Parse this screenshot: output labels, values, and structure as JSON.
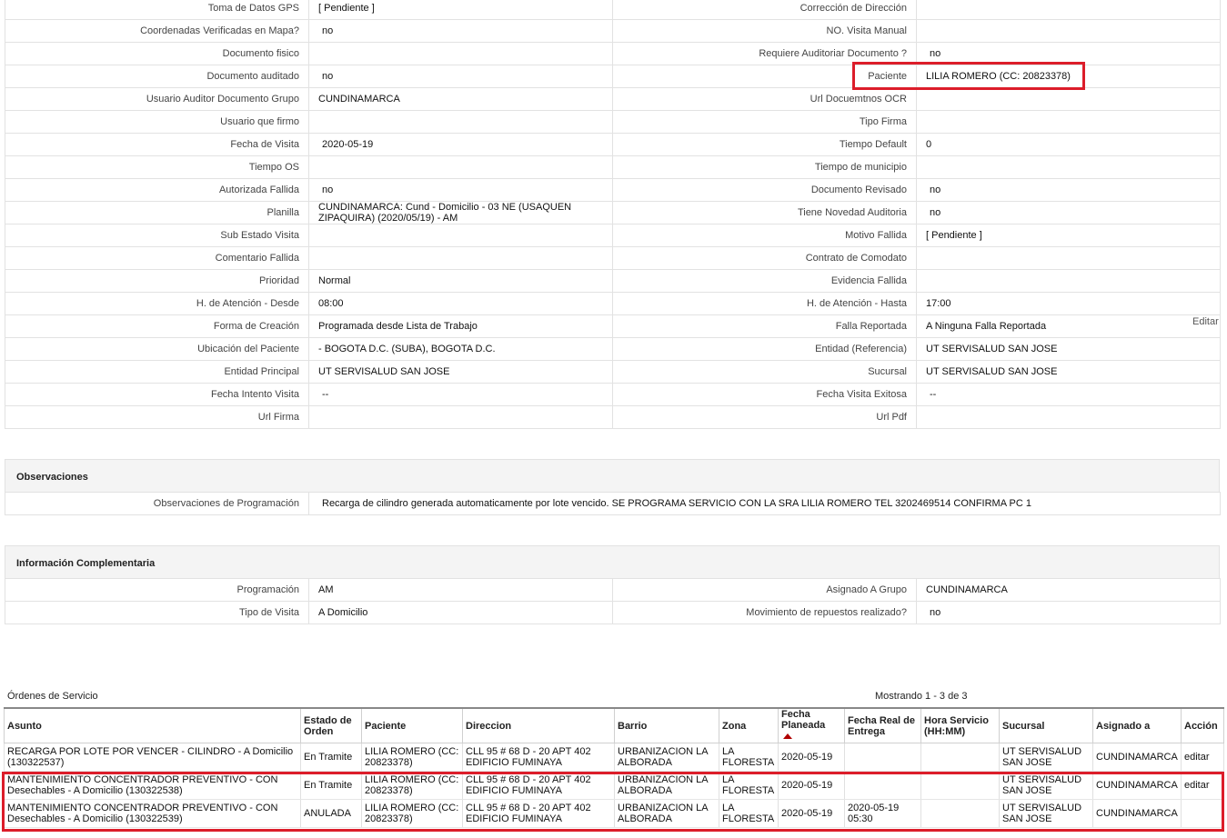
{
  "detail_rows": [
    {
      "l1": "Toma de Datos GPS",
      "v1": "[ Pendiente ]",
      "l2": "Corrección de Dirección",
      "v2": ""
    },
    {
      "l1": "Coordenadas Verificadas en Mapa?",
      "v1": "no",
      "l2": "NO. Visita Manual",
      "v2": ""
    },
    {
      "l1": "Documento fisico",
      "v1": "",
      "l2": "Requiere Auditoriar Documento ?",
      "v2": "no"
    },
    {
      "l1": "Documento auditado",
      "v1": "no",
      "l2": "Paciente",
      "v2": "LILIA ROMERO (CC: 20823378)"
    },
    {
      "l1": "Usuario Auditor Documento Grupo",
      "v1": "CUNDINAMARCA",
      "l2": "Url Docuemtnos OCR",
      "v2": ""
    },
    {
      "l1": "Usuario que firmo",
      "v1": "",
      "l2": "Tipo Firma",
      "v2": ""
    },
    {
      "l1": "Fecha de Visita",
      "v1": "2020-05-19",
      "l2": "Tiempo Default",
      "v2": "0"
    },
    {
      "l1": "Tiempo OS",
      "v1": "",
      "l2": "Tiempo de municipio",
      "v2": ""
    },
    {
      "l1": "Autorizada Fallida",
      "v1": "no",
      "l2": "Documento Revisado",
      "v2": "no"
    },
    {
      "l1": "Planilla",
      "v1": "CUNDINAMARCA: Cund - Domicilio - 03 NE (USAQUEN ZIPAQUIRA) (2020/05/19) - AM",
      "l2": "Tiene Novedad Auditoria",
      "v2": "no"
    },
    {
      "l1": "Sub Estado Visita",
      "v1": "",
      "l2": "Motivo Fallida",
      "v2": "[ Pendiente ]"
    },
    {
      "l1": "Comentario Fallida",
      "v1": "",
      "l2": "Contrato de Comodato",
      "v2": ""
    },
    {
      "l1": "Prioridad",
      "v1": "Normal",
      "l2": "Evidencia Fallida",
      "v2": ""
    },
    {
      "l1": "H. de Atención - Desde",
      "v1": "08:00",
      "l2": "H. de Atención - Hasta",
      "v2": "17:00"
    },
    {
      "l1": "Forma de Creación",
      "v1": "Programada desde Lista de Trabajo",
      "l2": "Falla Reportada",
      "v2": "A Ninguna Falla Reportada"
    },
    {
      "l1": "Ubicación del Paciente",
      "v1": "- BOGOTA D.C. (SUBA), BOGOTA D.C.",
      "l2": "Entidad (Referencia)",
      "v2": "UT SERVISALUD SAN JOSE"
    },
    {
      "l1": "Entidad Principal",
      "v1": "UT SERVISALUD SAN JOSE",
      "l2": "Sucursal",
      "v2": "UT SERVISALUD SAN JOSE"
    },
    {
      "l1": "Fecha Intento Visita",
      "v1": "--",
      "l2": "Fecha Visita Exitosa",
      "v2": "--"
    },
    {
      "l1": "Url Firma",
      "v1": "",
      "l2": "Url Pdf",
      "v2": ""
    }
  ],
  "editar_label": "Editar",
  "observaciones": {
    "title": "Observaciones",
    "label": "Observaciones de Programación",
    "value": "Recarga de cilindro generada automaticamente por lote vencido. SE PROGRAMA SERVICIO CON LA SRA LILIA ROMERO TEL 3202469514 CONFIRMA PC 1"
  },
  "complementaria": {
    "title": "Información Complementaria",
    "rows": [
      {
        "l1": "Programación",
        "v1": "AM",
        "l2": "Asignado A Grupo",
        "v2": "CUNDINAMARCA"
      },
      {
        "l1": "Tipo de Visita",
        "v1": "A Domicilio",
        "l2": "Movimiento de repuestos realizado?",
        "v2": "no"
      }
    ]
  },
  "orders": {
    "title": "Órdenes de Servicio",
    "count_text": "Mostrando 1 - 3 de 3",
    "headers": [
      "Asunto",
      "Estado de Orden",
      "Paciente",
      "Direccion",
      "Barrio",
      "Zona",
      "Fecha Planeada",
      "Fecha Real de Entrega",
      "Hora Servicio (HH:MM)",
      "Sucursal",
      "Asignado a",
      "Acción"
    ],
    "rows": [
      {
        "asunto": "RECARGA POR LOTE POR VENCER - CILINDRO - A Domicilio (130322537)",
        "estado": "En Tramite",
        "paciente": "LILIA ROMERO (CC: 20823378)",
        "direccion": "CLL 95 # 68 D - 20 APT 402 EDIFICIO FUMINAYA",
        "barrio": "URBANIZACION LA ALBORADA",
        "zona": "LA FLORESTA",
        "fecha_planeada": "2020-05-19",
        "fecha_real": "",
        "hora": "",
        "sucursal": "UT SERVISALUD SAN JOSE",
        "asignado": "CUNDINAMARCA",
        "accion": "editar"
      },
      {
        "asunto": "MANTENIMIENTO CONCENTRADOR PREVENTIVO - CON Desechables - A Domicilio (130322538)",
        "estado": "En Tramite",
        "paciente": "LILIA ROMERO (CC: 20823378)",
        "direccion": "CLL 95 # 68 D - 20 APT 402 EDIFICIO FUMINAYA",
        "barrio": "URBANIZACION LA ALBORADA",
        "zona": "LA FLORESTA",
        "fecha_planeada": "2020-05-19",
        "fecha_real": "",
        "hora": "",
        "sucursal": "UT SERVISALUD SAN JOSE",
        "asignado": "CUNDINAMARCA",
        "accion": "editar"
      },
      {
        "asunto": "MANTENIMIENTO CONCENTRADOR PREVENTIVO - CON Desechables - A Domicilio (130322539)",
        "estado": "ANULADA",
        "paciente": "LILIA ROMERO (CC: 20823378)",
        "direccion": "CLL 95 # 68 D - 20 APT 402 EDIFICIO FUMINAYA",
        "barrio": "URBANIZACION LA ALBORADA",
        "zona": "LA FLORESTA",
        "fecha_planeada": "2020-05-19",
        "fecha_real": "2020-05-19 05:30",
        "hora": "",
        "sucursal": "UT SERVISALUD SAN JOSE",
        "asignado": "CUNDINAMARCA",
        "accion": ""
      }
    ]
  },
  "colors": {
    "highlight": "#dc1d2a",
    "sort_arrow": "#b00000"
  }
}
